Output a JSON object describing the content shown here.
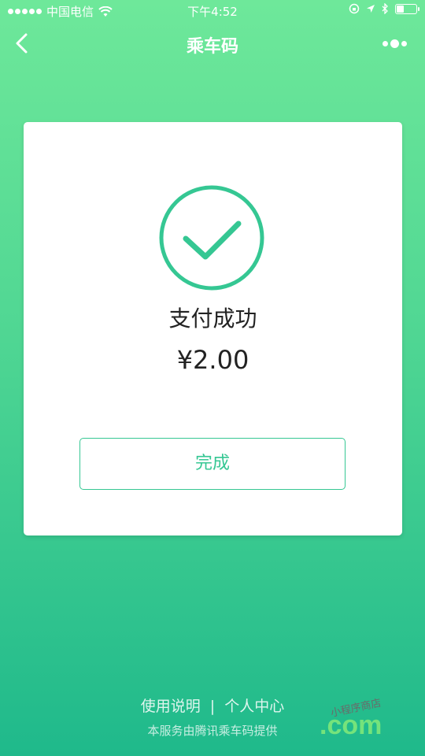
{
  "status_bar": {
    "carrier": "中国电信",
    "time": "下午4:52",
    "battery_level": 0.35
  },
  "nav": {
    "title": "乘车码",
    "back_icon": "chevron-left-icon",
    "more_icon": "more-dots-icon"
  },
  "card": {
    "status_text": "支付成功",
    "amount": "¥2.00",
    "done_label": "完成",
    "icon": "check-circle-icon",
    "accent_color": "#35c793"
  },
  "footer": {
    "help_link": "使用说明",
    "separator": "|",
    "profile_link": "个人中心",
    "note": "本服务由腾讯乘车码提供"
  },
  "watermark": {
    "brand": ".com",
    "tagline": "小程序商店"
  }
}
